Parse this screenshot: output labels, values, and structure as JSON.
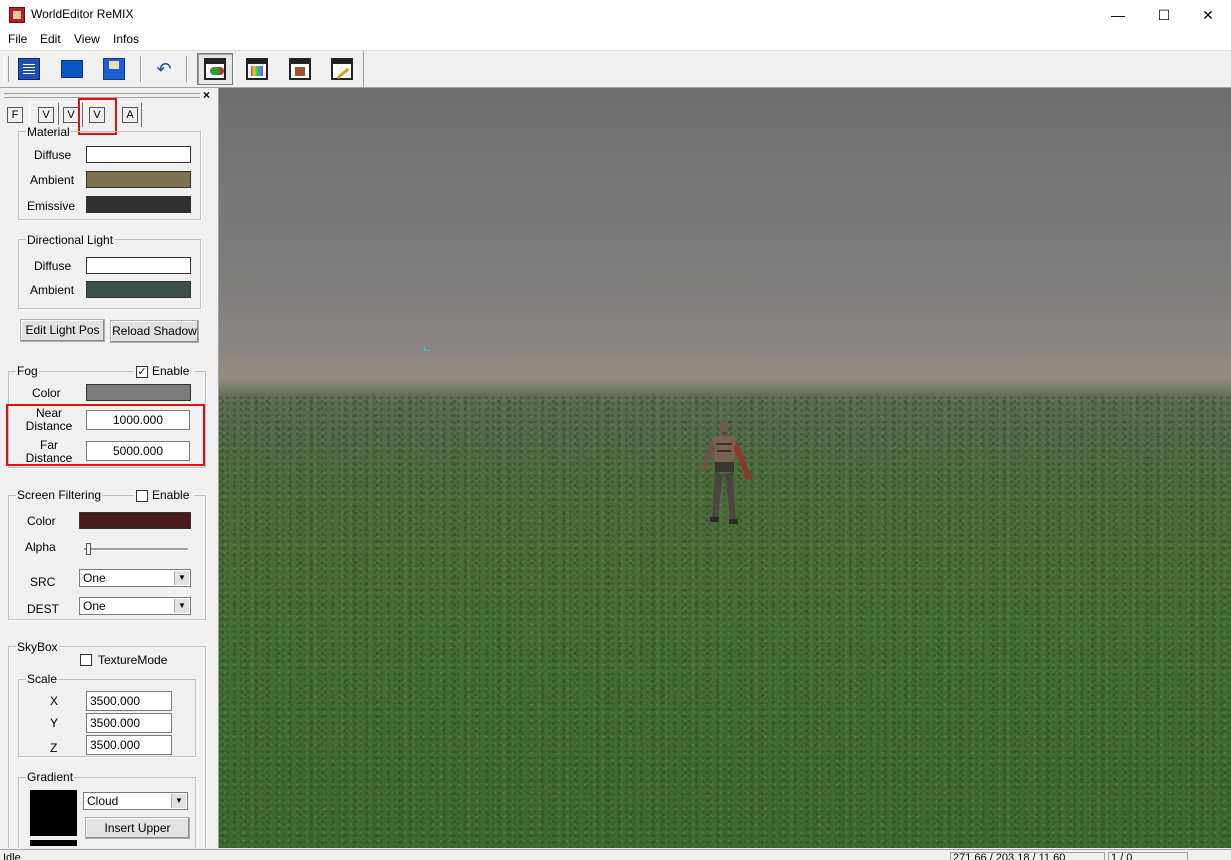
{
  "window": {
    "title": "WorldEditor ReMIX",
    "minimize_glyph": "—",
    "maximize_glyph": "☐",
    "close_glyph": "✕"
  },
  "menu": [
    "File",
    "Edit",
    "View",
    "Infos"
  ],
  "toolbar": {
    "buttons": [
      "document-icon",
      "folder-icon",
      "save-icon",
      "undo-icon",
      "terrain-window-icon",
      "palette-window-icon",
      "texture-window-icon",
      "brush-window-icon"
    ],
    "undo_glyph": "↶"
  },
  "panel": {
    "close_glyph": "×",
    "tabs": [
      "F",
      "V",
      "V",
      "V",
      "A"
    ],
    "material": {
      "title": "Material",
      "diffuse_label": "Diffuse",
      "ambient_label": "Ambient",
      "emissive_label": "Emissive",
      "diffuse_color": "#ffffff",
      "ambient_color": "#7e7150",
      "emissive_color": "#303030"
    },
    "directional_light": {
      "title": "Directional Light",
      "diffuse_label": "Diffuse",
      "ambient_label": "Ambient",
      "diffuse_color": "#ffffff",
      "ambient_color": "#3c4f4b"
    },
    "buttons": {
      "edit_light_pos": "Edit Light Pos",
      "reload_shadow": "Reload Shadow"
    },
    "fog": {
      "title": "Fog",
      "enable_label": "Enable",
      "enabled": true,
      "check_glyph": "✓",
      "color_label": "Color",
      "color": "#7b7b7b",
      "near_label_1": "Near",
      "near_label_2": "Distance",
      "near_value": "1000.000",
      "far_label_1": "Far",
      "far_label_2": "Distance",
      "far_value": "5000.000"
    },
    "screen_filtering": {
      "title": "Screen Filtering",
      "enable_label": "Enable",
      "enabled": false,
      "color_label": "Color",
      "color": "#4a1b1b",
      "alpha_label": "Alpha",
      "alpha_level": 0.0,
      "src_label": "SRC",
      "src_value": "One",
      "dest_label": "DEST",
      "dest_value": "One"
    },
    "skybox": {
      "title": "SkyBox",
      "texture_mode_label": "TextureMode",
      "texture_mode": false,
      "scale_title": "Scale",
      "x_label": "X",
      "y_label": "Y",
      "z_label": "Z",
      "x_value": "3500.000",
      "y_value": "3500.000",
      "z_value": "3500.000",
      "gradient_title": "Gradient",
      "gradient_select": "Cloud",
      "insert_upper": "Insert Upper"
    }
  },
  "status": {
    "text": "Idle",
    "coords": "271.66 / 203.18 / 11.60",
    "counter": "1 / 0"
  }
}
